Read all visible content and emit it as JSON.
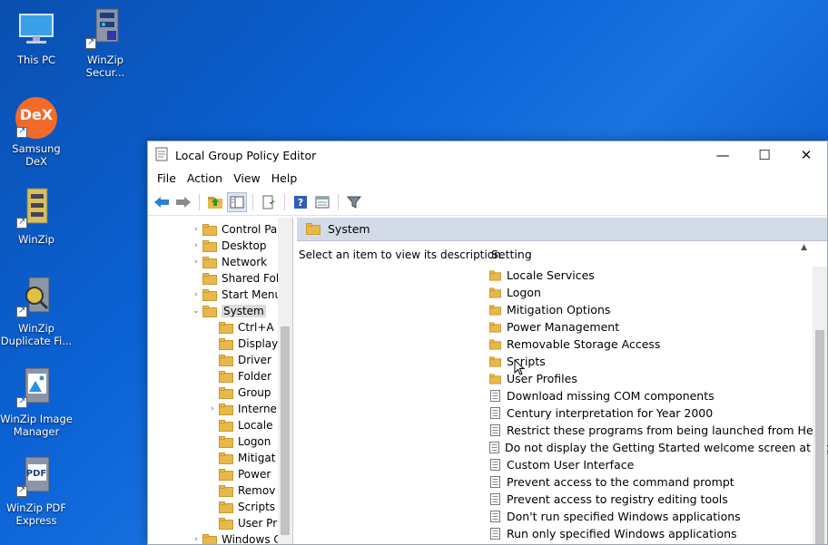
{
  "desktop": {
    "icons": [
      {
        "label": "This PC",
        "icon": "monitor-icon"
      },
      {
        "label": "WinZip Secur...",
        "icon": "winzip-secure-icon"
      },
      {
        "label": "Samsung DeX",
        "icon": "dex-icon",
        "badge": "DeX"
      },
      {
        "label": "WinZip",
        "icon": "winzip-icon"
      },
      {
        "label": "WinZip Duplicate Fi...",
        "icon": "winzip-duplicate-icon"
      },
      {
        "label": "WinZip Image Manager",
        "icon": "winzip-image-icon"
      },
      {
        "label": "WinZip PDF Express",
        "icon": "winzip-pdf-icon",
        "badge": "PDF"
      }
    ]
  },
  "window": {
    "title": "Local Group Policy Editor",
    "controls": {
      "minimize": "—",
      "maximize": "☐",
      "close": "✕"
    }
  },
  "menubar": [
    "File",
    "Action",
    "View",
    "Help"
  ],
  "tree": {
    "items": [
      {
        "label": "Control Pa",
        "expander": "›",
        "level": 0
      },
      {
        "label": "Desktop",
        "expander": "›",
        "level": 0
      },
      {
        "label": "Network",
        "expander": "›",
        "level": 0
      },
      {
        "label": "Shared Fol",
        "expander": "",
        "level": 0
      },
      {
        "label": "Start Menu",
        "expander": "›",
        "level": 0
      },
      {
        "label": "System",
        "expander": "⌄",
        "level": 0,
        "selected": true
      },
      {
        "label": "Ctrl+A",
        "expander": "",
        "level": 1
      },
      {
        "label": "Display",
        "expander": "",
        "level": 1
      },
      {
        "label": "Driver",
        "expander": "",
        "level": 1
      },
      {
        "label": "Folder",
        "expander": "",
        "level": 1
      },
      {
        "label": "Group",
        "expander": "",
        "level": 1
      },
      {
        "label": "Interne",
        "expander": "›",
        "level": 1
      },
      {
        "label": "Locale",
        "expander": "",
        "level": 1
      },
      {
        "label": "Logon",
        "expander": "",
        "level": 1
      },
      {
        "label": "Mitigat",
        "expander": "",
        "level": 1
      },
      {
        "label": "Power",
        "expander": "",
        "level": 1
      },
      {
        "label": "Remov",
        "expander": "",
        "level": 1
      },
      {
        "label": "Scripts",
        "expander": "",
        "level": 1
      },
      {
        "label": "User Pr",
        "expander": "",
        "level": 1
      },
      {
        "label": "Windows C",
        "expander": "›",
        "level": 0
      }
    ]
  },
  "right": {
    "header": "System",
    "description": "Select an item to view its description.",
    "column": "Setting",
    "rows": [
      {
        "label": "Locale Services",
        "type": "folder"
      },
      {
        "label": "Logon",
        "type": "folder"
      },
      {
        "label": "Mitigation Options",
        "type": "folder"
      },
      {
        "label": "Power Management",
        "type": "folder"
      },
      {
        "label": "Removable Storage Access",
        "type": "folder"
      },
      {
        "label": "Scripts",
        "type": "folder"
      },
      {
        "label": "User Profiles",
        "type": "folder"
      },
      {
        "label": "Download missing COM components",
        "type": "policy"
      },
      {
        "label": "Century interpretation for Year 2000",
        "type": "policy"
      },
      {
        "label": "Restrict these programs from being launched from Help",
        "type": "policy"
      },
      {
        "label": "Do not display the Getting Started welcome screen at logon",
        "type": "policy"
      },
      {
        "label": "Custom User Interface",
        "type": "policy"
      },
      {
        "label": "Prevent access to the command prompt",
        "type": "policy"
      },
      {
        "label": "Prevent access to registry editing tools",
        "type": "policy"
      },
      {
        "label": "Don't run specified Windows applications",
        "type": "policy"
      },
      {
        "label": "Run only specified Windows applications",
        "type": "policy"
      }
    ]
  },
  "colors": {
    "folder": "#e8b84a",
    "folder_dark": "#c99a2e",
    "header_bg": "#d4dbe8",
    "accent": "#1a5fd0"
  }
}
